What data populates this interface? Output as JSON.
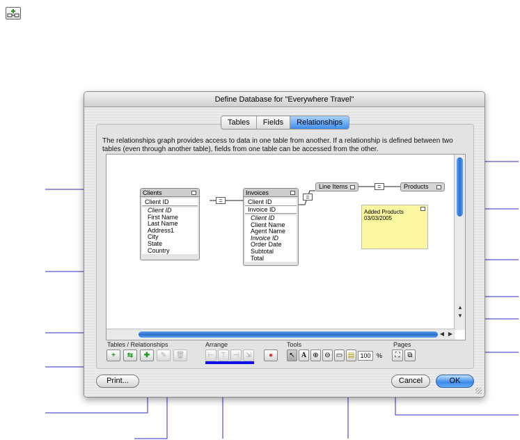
{
  "dialog": {
    "title": "Define Database for \"Everywhere Travel\"",
    "tabs": [
      {
        "label": "Tables"
      },
      {
        "label": "Fields"
      },
      {
        "label": "Relationships"
      }
    ],
    "description": "The relationships graph provides access to data in one table from another. If a relationship is defined between two tables (even through another table), fields from one table can be accessed from the other."
  },
  "graph": {
    "clients": {
      "title": "Clients",
      "key": "Client ID",
      "fields": [
        "Client ID",
        "First Name",
        "Last Name",
        "Address1",
        "City",
        "State",
        "Country"
      ]
    },
    "invoices": {
      "title": "Invoices",
      "keys": [
        "Client ID",
        "Invoice ID"
      ],
      "fields": [
        "Client ID",
        "Client Name",
        "Agent Name",
        "Invoice ID",
        "Order Date",
        "Subtotal",
        "Total"
      ]
    },
    "line_items": {
      "title": "Line Items"
    },
    "products": {
      "title": "Products"
    },
    "note": {
      "line1": "Added Products",
      "line2": "03/03/2005"
    },
    "eq": "="
  },
  "toolbar": {
    "tables_label": "Tables / Relationships",
    "arrange_label": "Arrange",
    "tools_label": "Tools",
    "pages_label": "Pages",
    "zoom_value": "100",
    "zoom_unit": "%"
  },
  "buttons": {
    "print": "Print...",
    "cancel": "Cancel",
    "ok": "OK"
  }
}
